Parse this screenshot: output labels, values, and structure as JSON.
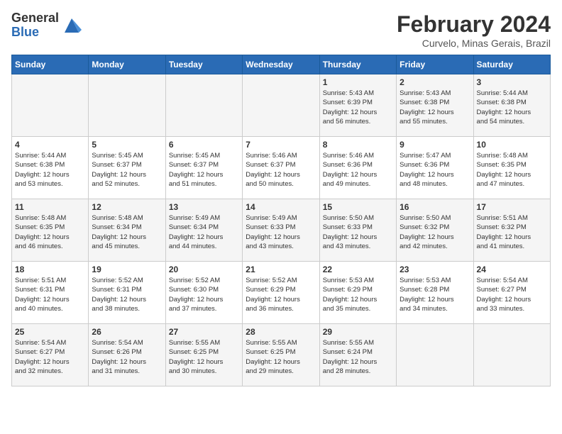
{
  "logo": {
    "general": "General",
    "blue": "Blue"
  },
  "title": {
    "month_year": "February 2024",
    "location": "Curvelo, Minas Gerais, Brazil"
  },
  "days_of_week": [
    "Sunday",
    "Monday",
    "Tuesday",
    "Wednesday",
    "Thursday",
    "Friday",
    "Saturday"
  ],
  "weeks": [
    [
      {
        "day": "",
        "info": ""
      },
      {
        "day": "",
        "info": ""
      },
      {
        "day": "",
        "info": ""
      },
      {
        "day": "",
        "info": ""
      },
      {
        "day": "1",
        "info": "Sunrise: 5:43 AM\nSunset: 6:39 PM\nDaylight: 12 hours\nand 56 minutes."
      },
      {
        "day": "2",
        "info": "Sunrise: 5:43 AM\nSunset: 6:38 PM\nDaylight: 12 hours\nand 55 minutes."
      },
      {
        "day": "3",
        "info": "Sunrise: 5:44 AM\nSunset: 6:38 PM\nDaylight: 12 hours\nand 54 minutes."
      }
    ],
    [
      {
        "day": "4",
        "info": "Sunrise: 5:44 AM\nSunset: 6:38 PM\nDaylight: 12 hours\nand 53 minutes."
      },
      {
        "day": "5",
        "info": "Sunrise: 5:45 AM\nSunset: 6:37 PM\nDaylight: 12 hours\nand 52 minutes."
      },
      {
        "day": "6",
        "info": "Sunrise: 5:45 AM\nSunset: 6:37 PM\nDaylight: 12 hours\nand 51 minutes."
      },
      {
        "day": "7",
        "info": "Sunrise: 5:46 AM\nSunset: 6:37 PM\nDaylight: 12 hours\nand 50 minutes."
      },
      {
        "day": "8",
        "info": "Sunrise: 5:46 AM\nSunset: 6:36 PM\nDaylight: 12 hours\nand 49 minutes."
      },
      {
        "day": "9",
        "info": "Sunrise: 5:47 AM\nSunset: 6:36 PM\nDaylight: 12 hours\nand 48 minutes."
      },
      {
        "day": "10",
        "info": "Sunrise: 5:48 AM\nSunset: 6:35 PM\nDaylight: 12 hours\nand 47 minutes."
      }
    ],
    [
      {
        "day": "11",
        "info": "Sunrise: 5:48 AM\nSunset: 6:35 PM\nDaylight: 12 hours\nand 46 minutes."
      },
      {
        "day": "12",
        "info": "Sunrise: 5:48 AM\nSunset: 6:34 PM\nDaylight: 12 hours\nand 45 minutes."
      },
      {
        "day": "13",
        "info": "Sunrise: 5:49 AM\nSunset: 6:34 PM\nDaylight: 12 hours\nand 44 minutes."
      },
      {
        "day": "14",
        "info": "Sunrise: 5:49 AM\nSunset: 6:33 PM\nDaylight: 12 hours\nand 43 minutes."
      },
      {
        "day": "15",
        "info": "Sunrise: 5:50 AM\nSunset: 6:33 PM\nDaylight: 12 hours\nand 43 minutes."
      },
      {
        "day": "16",
        "info": "Sunrise: 5:50 AM\nSunset: 6:32 PM\nDaylight: 12 hours\nand 42 minutes."
      },
      {
        "day": "17",
        "info": "Sunrise: 5:51 AM\nSunset: 6:32 PM\nDaylight: 12 hours\nand 41 minutes."
      }
    ],
    [
      {
        "day": "18",
        "info": "Sunrise: 5:51 AM\nSunset: 6:31 PM\nDaylight: 12 hours\nand 40 minutes."
      },
      {
        "day": "19",
        "info": "Sunrise: 5:52 AM\nSunset: 6:31 PM\nDaylight: 12 hours\nand 38 minutes."
      },
      {
        "day": "20",
        "info": "Sunrise: 5:52 AM\nSunset: 6:30 PM\nDaylight: 12 hours\nand 37 minutes."
      },
      {
        "day": "21",
        "info": "Sunrise: 5:52 AM\nSunset: 6:29 PM\nDaylight: 12 hours\nand 36 minutes."
      },
      {
        "day": "22",
        "info": "Sunrise: 5:53 AM\nSunset: 6:29 PM\nDaylight: 12 hours\nand 35 minutes."
      },
      {
        "day": "23",
        "info": "Sunrise: 5:53 AM\nSunset: 6:28 PM\nDaylight: 12 hours\nand 34 minutes."
      },
      {
        "day": "24",
        "info": "Sunrise: 5:54 AM\nSunset: 6:27 PM\nDaylight: 12 hours\nand 33 minutes."
      }
    ],
    [
      {
        "day": "25",
        "info": "Sunrise: 5:54 AM\nSunset: 6:27 PM\nDaylight: 12 hours\nand 32 minutes."
      },
      {
        "day": "26",
        "info": "Sunrise: 5:54 AM\nSunset: 6:26 PM\nDaylight: 12 hours\nand 31 minutes."
      },
      {
        "day": "27",
        "info": "Sunrise: 5:55 AM\nSunset: 6:25 PM\nDaylight: 12 hours\nand 30 minutes."
      },
      {
        "day": "28",
        "info": "Sunrise: 5:55 AM\nSunset: 6:25 PM\nDaylight: 12 hours\nand 29 minutes."
      },
      {
        "day": "29",
        "info": "Sunrise: 5:55 AM\nSunset: 6:24 PM\nDaylight: 12 hours\nand 28 minutes."
      },
      {
        "day": "",
        "info": ""
      },
      {
        "day": "",
        "info": ""
      }
    ]
  ]
}
